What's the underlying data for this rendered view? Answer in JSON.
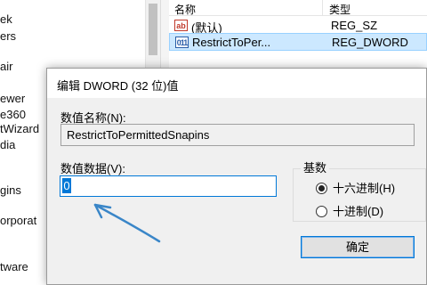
{
  "tree": {
    "items": [
      "ek",
      "ers",
      "air",
      "ewer",
      "e360",
      "tWizard",
      "dia",
      "gins",
      "orporat",
      "tware"
    ]
  },
  "list": {
    "header": {
      "name": "名称",
      "type": "类型"
    },
    "rows": [
      {
        "icon": "ab",
        "name": "(默认)",
        "type": "REG_SZ",
        "selected": false
      },
      {
        "icon": "011",
        "name": "RestrictToPer...",
        "type": "REG_DWORD",
        "selected": true
      }
    ]
  },
  "dialog": {
    "title": "编辑 DWORD (32 位)值",
    "name_label": "数值名称(N):",
    "name_value": "RestrictToPermittedSnapins",
    "data_label": "数值数据(V):",
    "data_value": "0",
    "base_label": "基数",
    "base_options": [
      {
        "label": "十六进制(H)",
        "checked": true
      },
      {
        "label": "十进制(D)",
        "checked": false
      }
    ],
    "ok_label": "确定"
  },
  "colors": {
    "accent": "#0078d7",
    "annotation_arrow": "#3a86c8",
    "selection_row": "#cce8ff"
  }
}
